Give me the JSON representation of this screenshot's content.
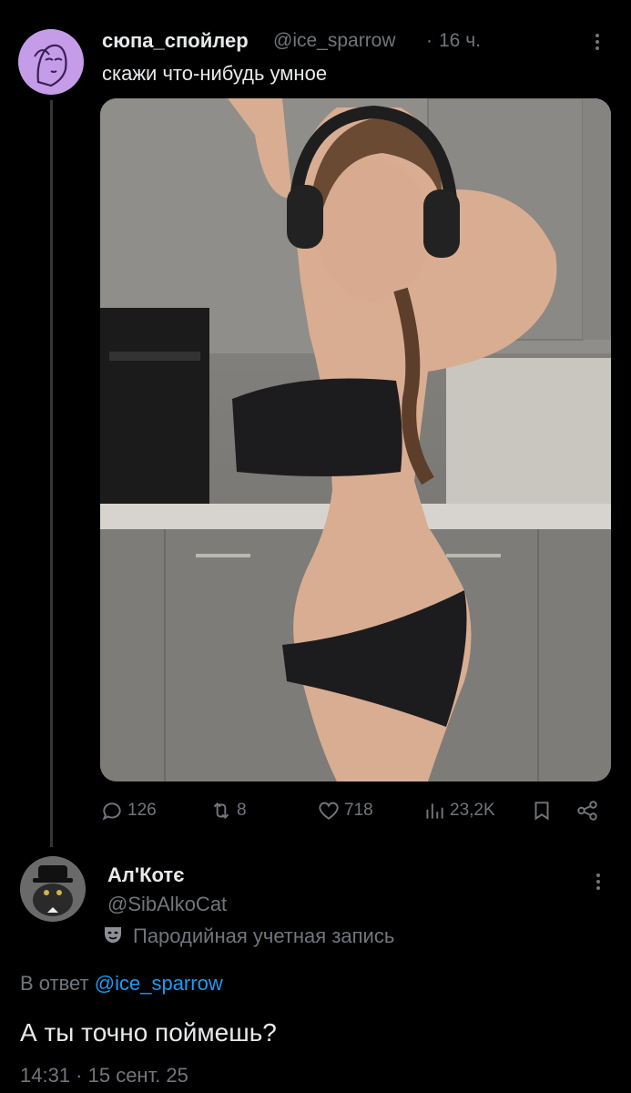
{
  "tweet": {
    "author_name": "сюпа_спойлер",
    "handle": "@ice_sparrow",
    "separator": "·",
    "time": "16 ч.",
    "text": "скажи что-нибудь умное",
    "stats": {
      "replies": "126",
      "retweets": "8",
      "likes": "718",
      "views": "23,2K"
    }
  },
  "reply_tweet": {
    "author_name": "Ал'Котє",
    "handle": "@SibAlkoCat",
    "badge_label": "Пародийная учетная запись",
    "reply_prefix": "В ответ",
    "reply_to": "@ice_sparrow",
    "text": "А ты точно поймешь?",
    "timestamp": "14:31 · 15 сент. 25"
  },
  "icons": [
    "more-icon",
    "reply-icon",
    "retweet-icon",
    "like-icon",
    "views-icon",
    "bookmark-icon",
    "share-icon",
    "parody-mask-icon"
  ]
}
